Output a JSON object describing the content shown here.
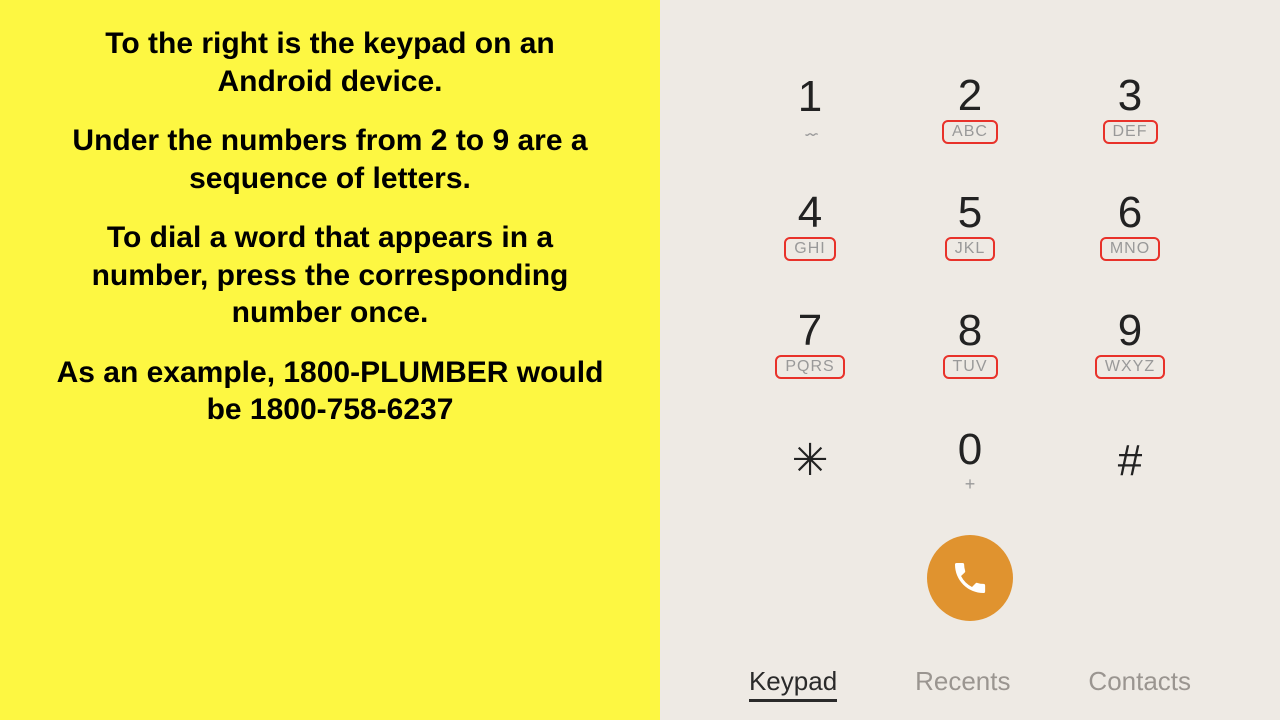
{
  "left": {
    "para1": "To the right is the keypad on an Android device.",
    "para2": "Under the numbers from 2 to 9 are a sequence of letters.",
    "para3": "To dial a word that appears in a number, press the corresponding number once.",
    "para4": "As an example, 1800-PLUMBER would be 1800-758-6237"
  },
  "keypad": {
    "k1": {
      "digit": "1",
      "sub": ""
    },
    "k2": {
      "digit": "2",
      "sub": "ABC"
    },
    "k3": {
      "digit": "3",
      "sub": "DEF"
    },
    "k4": {
      "digit": "4",
      "sub": "GHI"
    },
    "k5": {
      "digit": "5",
      "sub": "JKL"
    },
    "k6": {
      "digit": "6",
      "sub": "MNO"
    },
    "k7": {
      "digit": "7",
      "sub": "PQRS"
    },
    "k8": {
      "digit": "8",
      "sub": "TUV"
    },
    "k9": {
      "digit": "9",
      "sub": "WXYZ"
    },
    "kstar": {
      "digit": "✳"
    },
    "k0": {
      "digit": "0",
      "sub": "+"
    },
    "khash": {
      "digit": "#"
    }
  },
  "tabs": {
    "keypad": "Keypad",
    "recents": "Recents",
    "contacts": "Contacts"
  }
}
